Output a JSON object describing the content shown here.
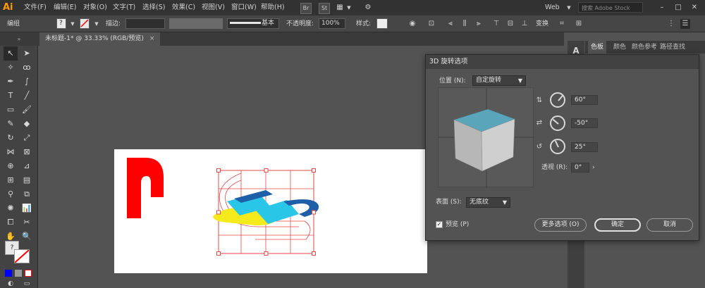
{
  "app": {
    "logo": "Ai"
  },
  "menu": [
    "文件(F)",
    "编辑(E)",
    "对象(O)",
    "文字(T)",
    "选择(S)",
    "效果(C)",
    "视图(V)",
    "窗口(W)",
    "帮助(H)"
  ],
  "menubar_right": {
    "bridge": "Br",
    "stock": "St",
    "workspace": "Web",
    "search_placeholder": "搜索 Adobe Stock"
  },
  "control_bar": {
    "group_label": "编组",
    "stroke_label": "描边:",
    "brush_label": "基本",
    "opacity_label": "不透明度:",
    "opacity_value": "100%",
    "style_label": "样式:",
    "transform_label": "变换"
  },
  "document_tab": {
    "title": "未标题-1* @ 33.33% (RGB/预览)",
    "close": "×"
  },
  "right_panel": {
    "tabs": [
      "色板",
      "颜色",
      "颜色参考",
      "路径查找"
    ]
  },
  "dialog": {
    "title": "3D 旋转选项",
    "position_label": "位置 (N):",
    "position_value": "自定旋转",
    "x_value": "60°",
    "y_value": "-50°",
    "z_value": "25°",
    "perspective_label": "透视 (R):",
    "perspective_value": "0°",
    "surface_label": "表面 (S):",
    "surface_value": "无底纹",
    "preview_label": "预览 (P)",
    "preview_checked": true,
    "more_options": "更多选项 (O)",
    "ok": "确定",
    "cancel": "取消"
  },
  "colors": {
    "cube_top": "#5ba5bb",
    "cube_front": "#c9c9c9",
    "accent_red": "#ff0000",
    "cyan": "#29c6e8",
    "yellow": "#f4ea1c",
    "blue": "#1e5fa8"
  },
  "artwork": {
    "glyph": "P"
  }
}
